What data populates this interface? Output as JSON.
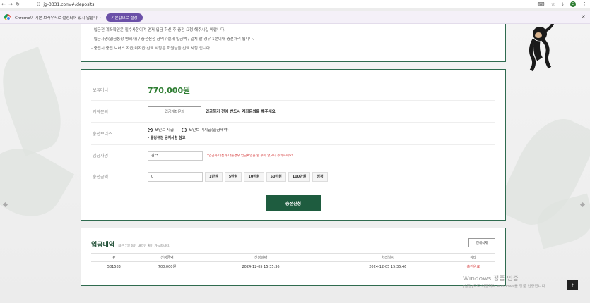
{
  "browser": {
    "url": "jg-3331.com/#/deposits",
    "profile_initial": "G"
  },
  "infobar": {
    "message": "Chrome이 기본 브라우저로 설정되어 있지 않습니다",
    "button": "기본값으로 설정"
  },
  "notice": {
    "lines": [
      "- 입금전 계좌확인은 필수사항이며 먼저 입금 하신 후 충전 요청 해주시길 바랍니다.",
      "- 입금자명(입금통장 명의자) / 충전신청 금액 / 실제 입금액 / 일치 할 경우 1분이내 충전처리 됩니다.",
      "- 충전시 충전 보너스 지급/미지급 선택 사항은 회원님을 선택 사항 입니다."
    ]
  },
  "form": {
    "balance_label": "보유머니",
    "balance_value": "770,000원",
    "account_label": "계좌문의",
    "account_button": "입금계좌문의",
    "account_note": "입금하기 전에 반드시 계좌문의를 해주세요",
    "bonus_label": "충전보너스",
    "bonus_option_yes": "포인트 지급",
    "bonus_option_no": "포인트 미지급(출금제약)",
    "bonus_note": "- 롤링규정 공지사항 참고",
    "depositor_label": "입금자명",
    "depositor_value": "김**",
    "depositor_note": "*입금자 이름과 다를경우 입금확인을 할 수가 없으니 주의하세요!",
    "amount_label": "충전금액",
    "amount_value": "0",
    "amount_buttons": [
      "1만원",
      "5만원",
      "10만원",
      "50만원",
      "100만원",
      "정정"
    ],
    "submit": "충전신청"
  },
  "history": {
    "title": "입금내역",
    "subtitle": "최근 7일 동안 내역만 확인 가능합니다.",
    "delete_all": "전체삭제",
    "columns": [
      "#",
      "신청금액",
      "신청날짜",
      "처리일시",
      "상태"
    ],
    "rows": [
      [
        "581583",
        "700,000원",
        "2024-12-05 15:35:36",
        "2024-12-05 15:35:46",
        "충전완료"
      ]
    ]
  },
  "watermark": {
    "line1": "Windows 정품 인증",
    "line2": "[설정]으로 이동하여 Windows를 정품 인증합니다."
  },
  "colors": {
    "accent_green": "#1e5c3f",
    "money_green": "#2e7d32",
    "status_red": "#d32f2f"
  }
}
